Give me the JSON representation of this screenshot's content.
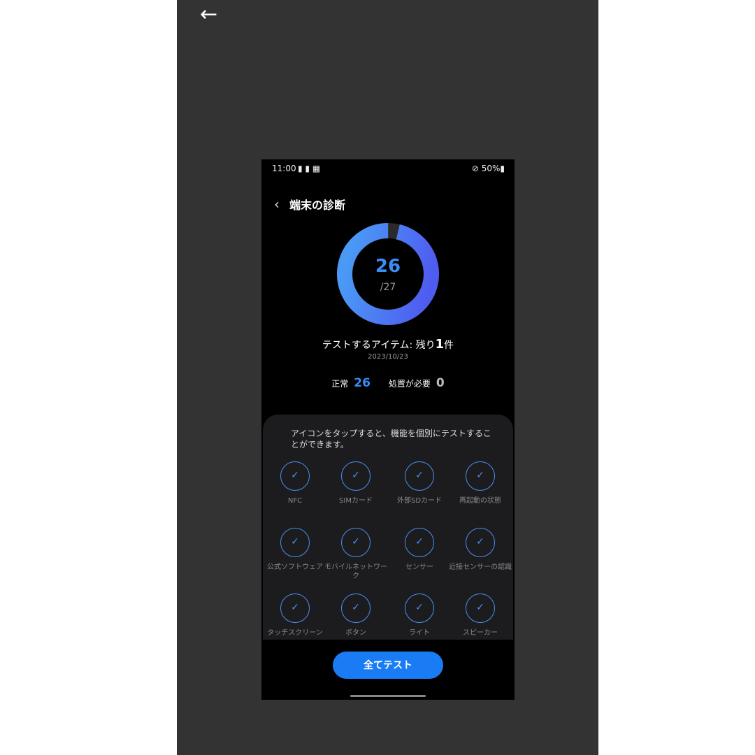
{
  "viewer": {
    "back_icon": "arrow-left-icon"
  },
  "status_bar": {
    "time": "11:00",
    "right": "50%",
    "battery_icon": "battery-icon"
  },
  "header": {
    "title": "端末の診断"
  },
  "summary": {
    "passed": "26",
    "total": "/27",
    "progress_fraction": 0.963,
    "remaining_prefix": "テストするアイテム: 残り",
    "remaining_count": "1",
    "remaining_suffix": "件",
    "date": "2023/10/23",
    "normal_label": "正常",
    "normal_count": "26",
    "action_label": "処置が必要",
    "action_count": "0",
    "colors": {
      "ring_start": "#4a9af5",
      "ring_end": "#4f5cf0",
      "ring_remaining": "#2a2a2a",
      "accent": "#1a7cf5"
    }
  },
  "panel": {
    "hint": "アイコンをタップすると、機能を個別にテストすることができます。",
    "items": [
      {
        "label": "NFC"
      },
      {
        "label": "SIMカード"
      },
      {
        "label": "外部SDカード"
      },
      {
        "label": "再起動の状態"
      },
      {
        "label": "公式ソフトウェア"
      },
      {
        "label": "モバイルネットワーク"
      },
      {
        "label": "センサー"
      },
      {
        "label": "近接センサーの認識"
      },
      {
        "label": "タッチスクリーン"
      },
      {
        "label": "ボタン"
      },
      {
        "label": "ライト"
      },
      {
        "label": "スピーカー"
      }
    ]
  },
  "footer": {
    "test_all": "全てテスト"
  }
}
